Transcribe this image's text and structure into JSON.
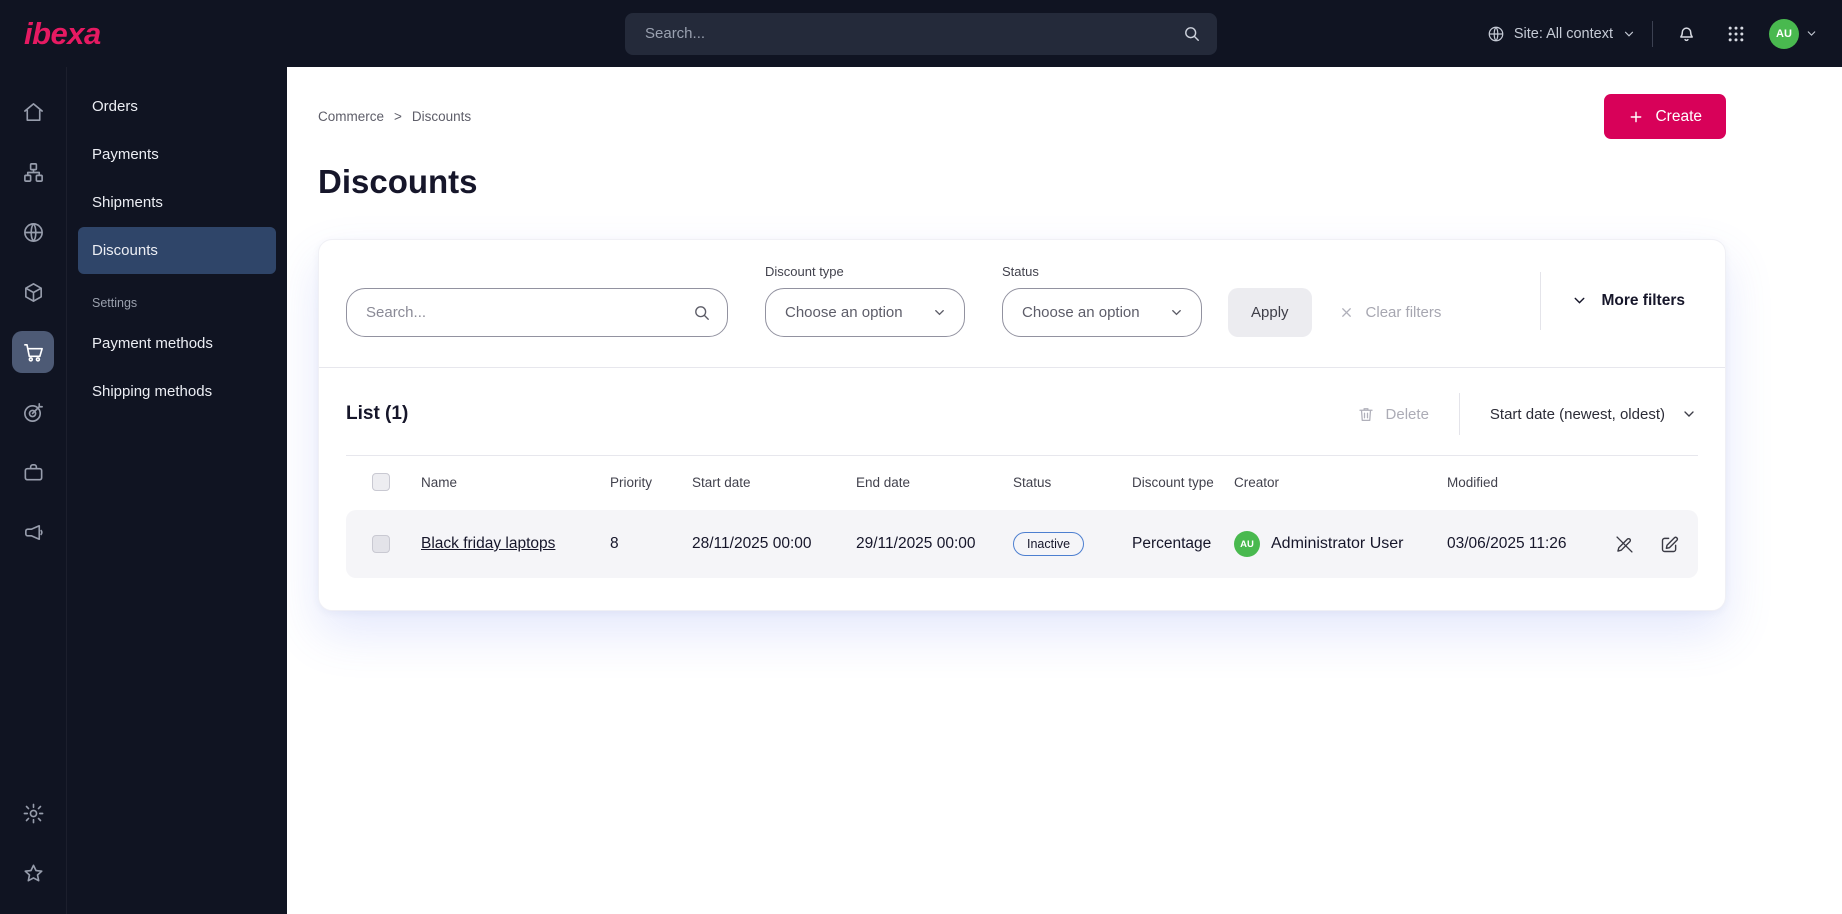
{
  "topbar": {
    "logo": "ibexa",
    "search_placeholder": "Search...",
    "site_context": "Site: All context",
    "avatar_initials": "AU"
  },
  "sidebar": {
    "icon_items": [
      "home",
      "content-structure",
      "site",
      "products",
      "commerce",
      "personalization",
      "workflow",
      "marketing",
      "settings",
      "bookmarks"
    ],
    "active_icon": "commerce"
  },
  "subnav": {
    "items": [
      {
        "label": "Orders",
        "active": false
      },
      {
        "label": "Payments",
        "active": false
      },
      {
        "label": "Shipments",
        "active": false
      },
      {
        "label": "Discounts",
        "active": true
      }
    ],
    "section_label": "Settings",
    "settings_items": [
      {
        "label": "Payment methods"
      },
      {
        "label": "Shipping methods"
      }
    ]
  },
  "main": {
    "breadcrumb": {
      "0": "Commerce",
      "separator": ">",
      "1": "Discounts"
    },
    "create_label": "Create",
    "title": "Discounts",
    "filters": {
      "search_placeholder": "Search...",
      "discount_type_label": "Discount type",
      "discount_type_value": "Choose an option",
      "status_label": "Status",
      "status_value": "Choose an option",
      "apply_label": "Apply",
      "clear_label": "Clear filters",
      "more_filters_label": "More filters"
    },
    "list": {
      "title": "List (1)",
      "delete_label": "Delete",
      "sort_label": "Start date (newest, oldest)",
      "columns": [
        "Name",
        "Priority",
        "Start date",
        "End date",
        "Status",
        "Discount type",
        "Creator",
        "Modified"
      ],
      "rows": [
        {
          "name": "Black friday laptops",
          "priority": "8",
          "start_date": "28/11/2025 00:00",
          "end_date": "29/11/2025 00:00",
          "status": "Inactive",
          "discount_type": "Percentage",
          "creator": "Administrator User",
          "creator_initials": "AU",
          "modified": "03/06/2025 11:26"
        }
      ]
    }
  },
  "colors": {
    "brand_pink": "#e61a62",
    "accent_button": "#d80159",
    "topbar_bg": "#101422",
    "sidebar_active_bg": "#2f4569",
    "status_badge_border": "#4d7fd0",
    "avatar_green": "#49b94f",
    "row_bg": "#f5f5f8"
  }
}
